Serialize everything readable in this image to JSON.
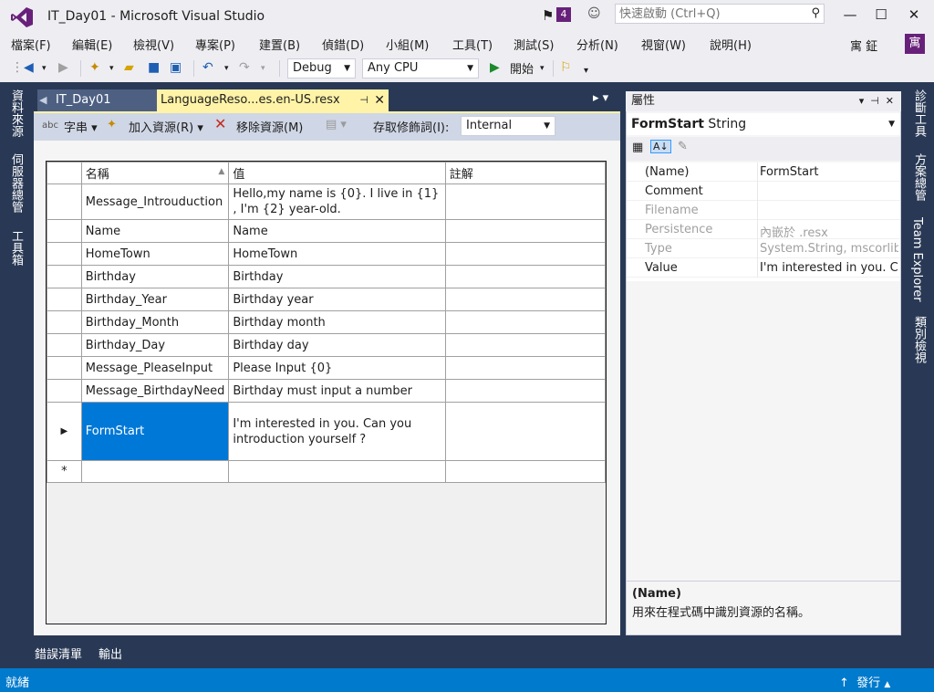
{
  "window": {
    "title": "IT_Day01 - Microsoft Visual Studio",
    "notification_count": "4",
    "quick_launch_placeholder": "快速啟動 (Ctrl+Q)",
    "user_name": "寓 鉦",
    "avatar_letter": "寓"
  },
  "menu": [
    "檔案(F)",
    "編輯(E)",
    "檢視(V)",
    "專案(P)",
    "建置(B)",
    "偵錯(D)",
    "小組(M)",
    "工具(T)",
    "測試(S)",
    "分析(N)",
    "視窗(W)",
    "說明(H)"
  ],
  "toolbar": {
    "config": "Debug",
    "platform": "Any CPU",
    "start_label": "開始"
  },
  "left_tabs": [
    "資料來源",
    "伺服器總管",
    "工具箱"
  ],
  "right_tabs": [
    "診斷工具",
    "方案總管",
    "Team Explorer",
    "類別檢視"
  ],
  "doc_tabs": {
    "tab1": "IT_Day01",
    "tab2": "LanguageReso...es.en-US.resx"
  },
  "editor_toolbar": {
    "strings_label": "字串",
    "add_resource_label": "加入資源(R)",
    "remove_resource_label": "移除資源(M)",
    "access_modifier_label": "存取修飾詞(I):",
    "access_modifier_value": "Internal"
  },
  "grid": {
    "headers": {
      "name": "名稱",
      "value": "值",
      "comment": "註解"
    },
    "rows": [
      {
        "name": "Message_Introuduction",
        "value": "Hello,my name is {0}. I live in {1} , I'm {2} year-old.",
        "comment": ""
      },
      {
        "name": "Name",
        "value": "Name",
        "comment": ""
      },
      {
        "name": "HomeTown",
        "value": "HomeTown",
        "comment": ""
      },
      {
        "name": "Birthday",
        "value": "Birthday",
        "comment": ""
      },
      {
        "name": "Birthday_Year",
        "value": "Birthday year",
        "comment": ""
      },
      {
        "name": "Birthday_Month",
        "value": "Birthday month",
        "comment": ""
      },
      {
        "name": "Birthday_Day",
        "value": "Birthday day",
        "comment": ""
      },
      {
        "name": "Message_PleaseInput",
        "value": "Please Input {0}",
        "comment": ""
      },
      {
        "name": "Message_BirthdayNeed",
        "value": "Birthday must input a number",
        "comment": ""
      },
      {
        "name": "FormStart",
        "value": "I'm interested in you. Can you introduction yourself ?",
        "comment": ""
      }
    ],
    "new_row_marker": "*",
    "current_row_marker": "▶"
  },
  "properties": {
    "panel_title": "屬性",
    "object_name": "FormStart",
    "object_type": "String",
    "rows": [
      {
        "name": "(Name)",
        "value": "FormStart",
        "enabled": true
      },
      {
        "name": "Comment",
        "value": "",
        "enabled": true
      },
      {
        "name": "Filename",
        "value": "",
        "enabled": false
      },
      {
        "name": "Persistence",
        "value": "內嵌於 .resx",
        "enabled": false
      },
      {
        "name": "Type",
        "value": "System.String, mscorlib",
        "enabled": false
      },
      {
        "name": "Value",
        "value": "I'm interested in you. Can you introduction yourself ?",
        "enabled": true
      }
    ],
    "desc_title": "(Name)",
    "desc_text": "用來在程式碼中識別資源的名稱。"
  },
  "bottom_tabs": [
    "錯誤清單",
    "輸出"
  ],
  "status": {
    "text": "就緒",
    "publish_label": "發行"
  },
  "colors": {
    "accent": "#007acc",
    "selection": "#0078d7",
    "vs_purple": "#68217a",
    "active_tab": "#fff3a7"
  }
}
